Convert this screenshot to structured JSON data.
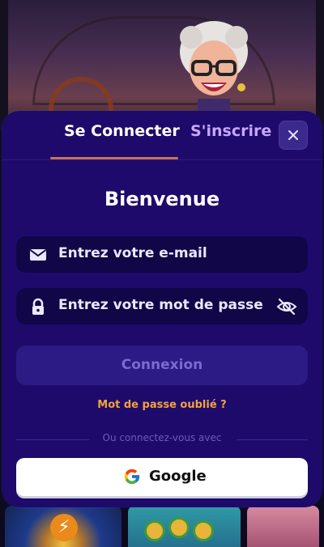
{
  "tabs": {
    "login": "Se Connecter",
    "register": "S'inscrire"
  },
  "title": "Bienvenue",
  "form": {
    "email_placeholder": "Entrez votre e-mail",
    "password_placeholder": "Entrez votre mot de passe",
    "submit_label": "Connexion",
    "forgot_label": "Mot de passe oublié ?",
    "divider_text": "Ou connectez-vous avec",
    "google_label": "Google"
  },
  "icons": {
    "close": "close-icon",
    "email": "envelope-icon",
    "password": "lock-icon",
    "toggle_visibility": "eye-slash-icon",
    "google": "google-icon"
  },
  "colors": {
    "modal_bg": "#1e0a6b",
    "field_bg": "#100648",
    "active_tab_underline": "#c8715e",
    "inactive_tab": "#c9a6ff",
    "forgot_link": "#f2a33c",
    "submit_disabled_bg": "#2c1b85"
  }
}
